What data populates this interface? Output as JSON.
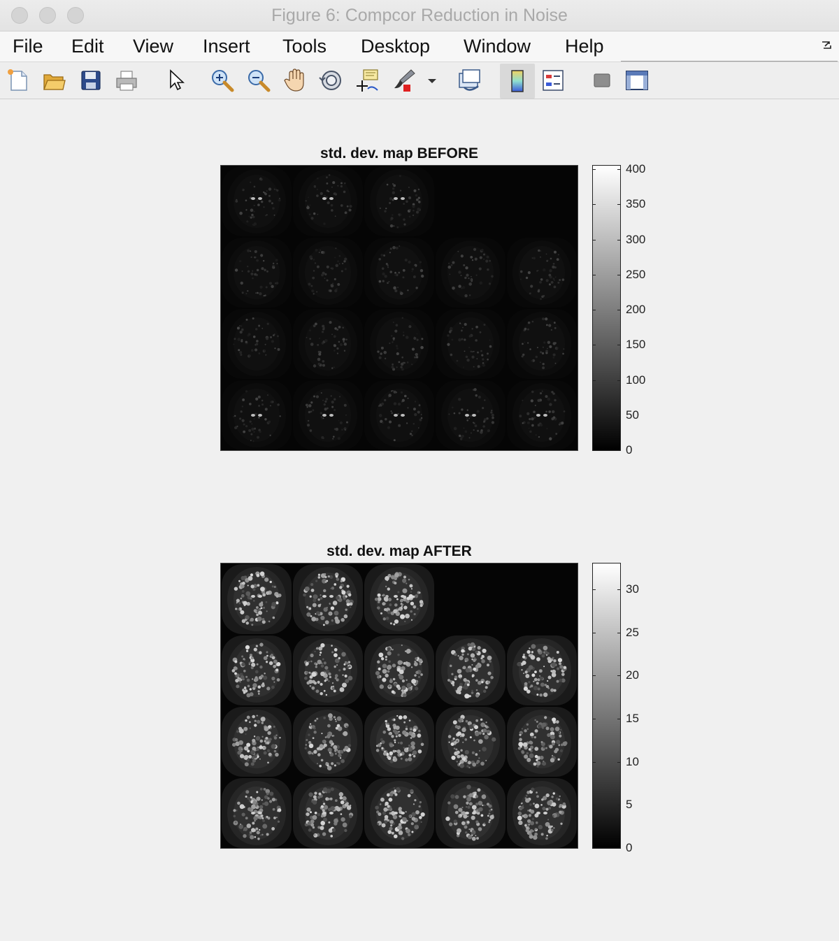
{
  "window": {
    "title": "Figure 6: Compcor Reduction in Noise"
  },
  "menubar": {
    "items": [
      "File",
      "Edit",
      "View",
      "Insert",
      "Tools",
      "Desktop",
      "Window",
      "Help"
    ]
  },
  "toolbar": {
    "icons": [
      "new-figure-icon",
      "open-file-icon",
      "save-icon",
      "print-icon",
      "select-cursor-icon",
      "zoom-in-icon",
      "zoom-out-icon",
      "pan-hand-icon",
      "rotate-3d-icon",
      "data-cursor-icon",
      "brush-icon",
      "brush-dropdown-icon",
      "link-plot-icon",
      "colorbar-icon",
      "legend-icon",
      "hide-plot-tools-icon",
      "show-plot-tools-icon"
    ]
  },
  "panels": [
    {
      "title": "std. dev. map BEFORE",
      "colorbar": {
        "min": 0,
        "max": 405,
        "ticks": [
          0,
          50,
          100,
          150,
          200,
          250,
          300,
          350,
          400
        ]
      }
    },
    {
      "title": "std. dev. map AFTER",
      "colorbar": {
        "min": 0,
        "max": 33,
        "ticks": [
          0,
          5,
          10,
          15,
          20,
          25,
          30
        ]
      }
    }
  ]
}
